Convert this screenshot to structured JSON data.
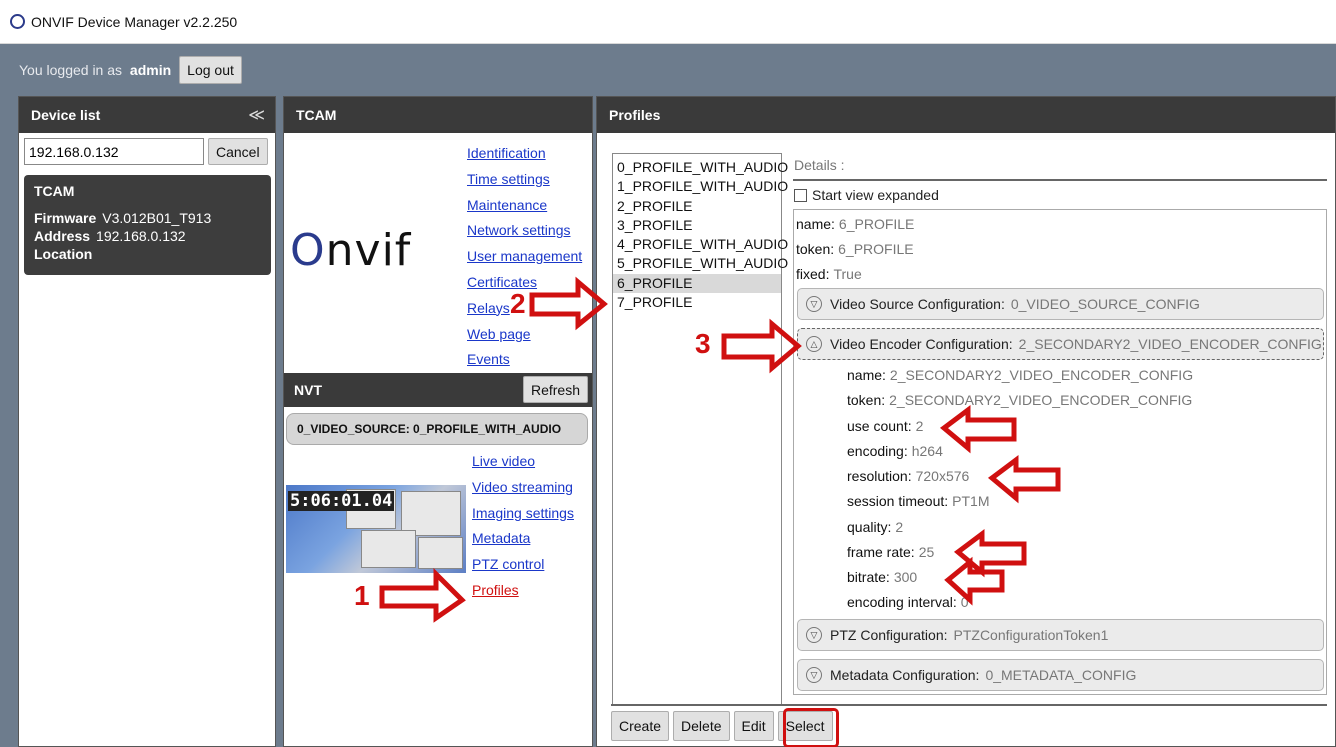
{
  "app": {
    "title": "ONVIF Device Manager v2.2.250"
  },
  "topbar": {
    "logged_in_prefix": "You logged in as",
    "username": "admin",
    "logout_label": "Log out"
  },
  "device_list": {
    "header": "Device list",
    "collapse_glyph": "≪",
    "search_value": "192.168.0.132",
    "cancel_label": "Cancel",
    "device": {
      "name": "TCAM",
      "firmware_label": "Firmware",
      "firmware_value": "V3.012B01_T913",
      "address_label": "Address",
      "address_value": "192.168.0.132",
      "location_label": "Location"
    }
  },
  "tcam": {
    "header": "TCAM",
    "logo_text": "nvif",
    "links": [
      "Identification",
      "Time settings",
      "Maintenance",
      "Network settings",
      "User management",
      "Certificates",
      "Relays",
      "Web page",
      "Events"
    ],
    "nvt_header": "NVT",
    "refresh_label": "Refresh",
    "video_source": "0_VIDEO_SOURCE: 0_PROFILE_WITH_AUDIO",
    "thumb_clock": "5:06:01.04",
    "nvt_links": [
      "Live video",
      "Video streaming",
      "Imaging settings",
      "Metadata",
      "PTZ control",
      "Profiles"
    ]
  },
  "profiles": {
    "header": "Profiles",
    "list": [
      "0_PROFILE_WITH_AUDIO",
      "1_PROFILE_WITH_AUDIO",
      "2_PROFILE",
      "3_PROFILE",
      "4_PROFILE_WITH_AUDIO",
      "5_PROFILE_WITH_AUDIO",
      "6_PROFILE",
      "7_PROFILE"
    ],
    "selected_index": 6,
    "details_label": "Details :",
    "start_expanded_label": "Start view expanded",
    "name_label": "name:",
    "name_value": "6_PROFILE",
    "token_label": "token:",
    "token_value": "6_PROFILE",
    "fixed_label": "fixed:",
    "fixed_value": "True",
    "vsc_label": "Video Source Configuration:",
    "vsc_value": "0_VIDEO_SOURCE_CONFIG",
    "vec_label": "Video Encoder Configuration:",
    "vec_value": "2_SECONDARY2_VIDEO_ENCODER_CONFIG",
    "encoder": {
      "name_label": "name:",
      "name_value": "2_SECONDARY2_VIDEO_ENCODER_CONFIG",
      "token_label": "token:",
      "token_value": "2_SECONDARY2_VIDEO_ENCODER_CONFIG",
      "use_count_label": "use count:",
      "use_count_value": "2",
      "encoding_label": "encoding:",
      "encoding_value": "h264",
      "resolution_label": "resolution:",
      "resolution_value": "720x576",
      "session_timeout_label": "session timeout:",
      "session_timeout_value": "PT1M",
      "quality_label": "quality:",
      "quality_value": "2",
      "frame_rate_label": "frame rate:",
      "frame_rate_value": "25",
      "bitrate_label": "bitrate:",
      "bitrate_value": "300",
      "encoding_interval_label": "encoding interval:",
      "encoding_interval_value": "0"
    },
    "ptz_label": "PTZ Configuration:",
    "ptz_value": "PTZConfigurationToken1",
    "meta_label": "Metadata Configuration:",
    "meta_value": "0_METADATA_CONFIG",
    "buttons": {
      "create": "Create",
      "delete": "Delete",
      "edit": "Edit",
      "select": "Select"
    }
  },
  "annotations": {
    "n1": "1",
    "n2": "2",
    "n3": "3",
    "color": "#d01010"
  },
  "colors": {
    "toolbar": "#6d7c8d",
    "panel_header": "#3a3a3a",
    "link": "#1a37c9",
    "active_link": "#d01010"
  }
}
